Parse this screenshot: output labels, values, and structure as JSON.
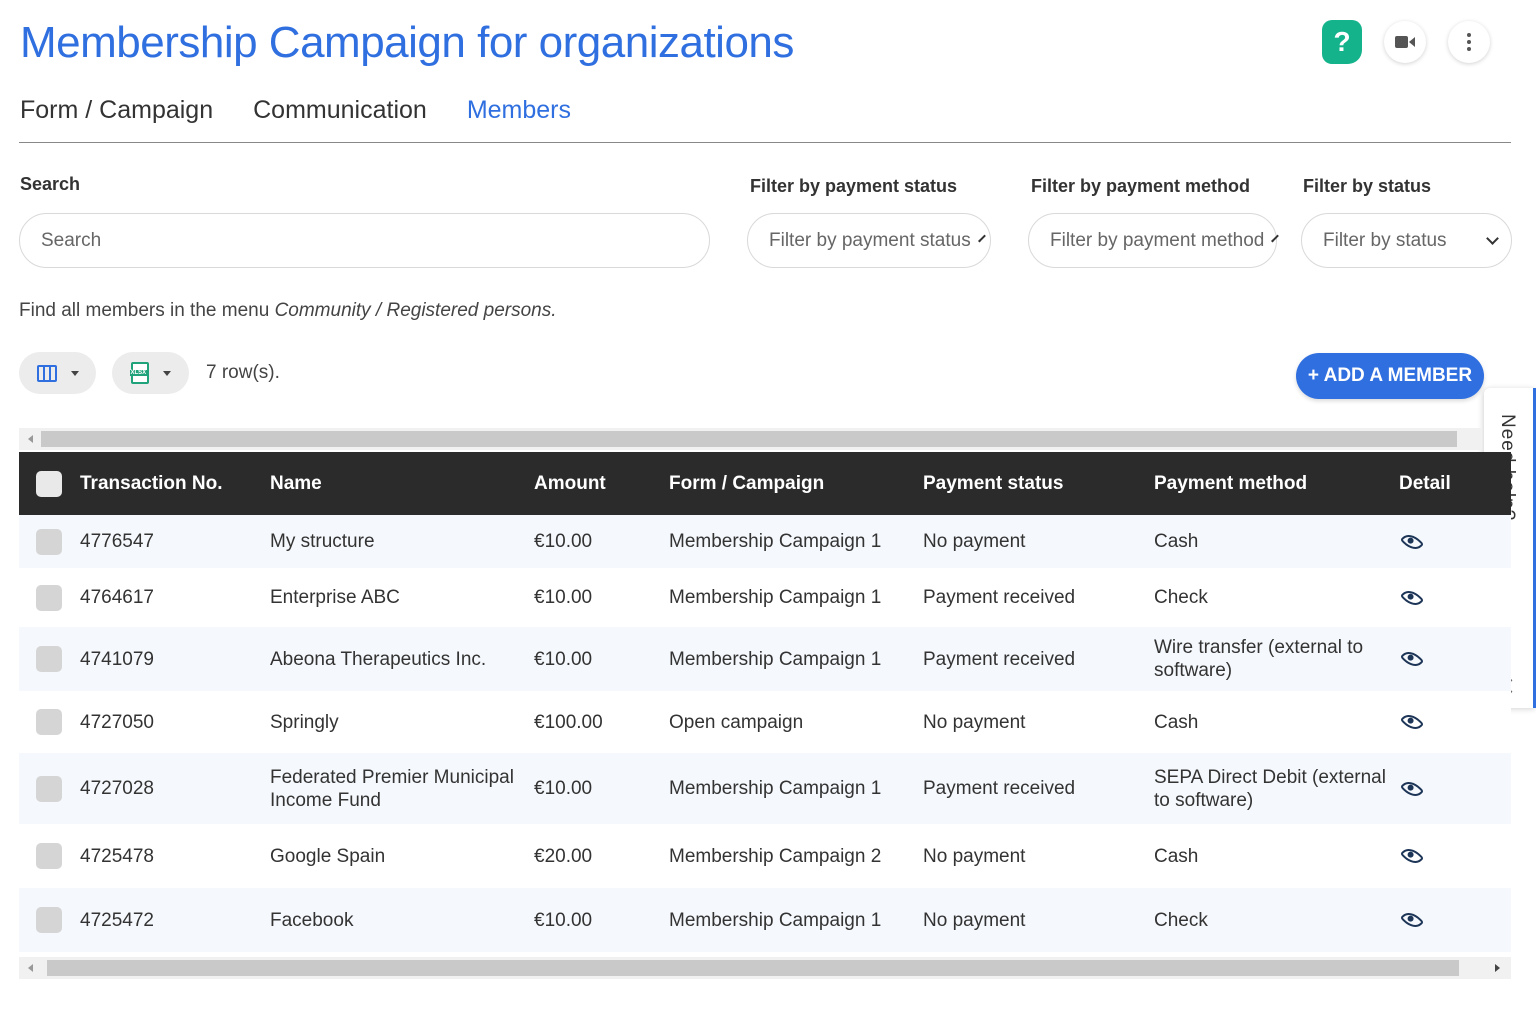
{
  "header": {
    "title": "Membership Campaign for organizations",
    "help_label": "?"
  },
  "tabs": [
    {
      "label": "Form / Campaign",
      "active": false
    },
    {
      "label": "Communication",
      "active": false
    },
    {
      "label": "Members",
      "active": true
    }
  ],
  "filters": {
    "search": {
      "label": "Search",
      "placeholder": "Search"
    },
    "payment_status": {
      "label": "Filter by payment status",
      "value": "Filter by payment status"
    },
    "payment_method": {
      "label": "Filter by payment method",
      "value": "Filter by payment method"
    },
    "status": {
      "label": "Filter by status",
      "value": "Filter by status"
    }
  },
  "info": {
    "prefix": "Find all members in the menu ",
    "menu_path": "Community / Registered persons."
  },
  "toolbar": {
    "row_count": "7 row(s).",
    "add_member_label": "+ ADD A MEMBER"
  },
  "side_panel": {
    "label": "Need help?"
  },
  "table": {
    "columns": [
      "Transaction No.",
      "Name",
      "Amount",
      "Form / Campaign",
      "Payment status",
      "Payment method",
      "Detail"
    ],
    "rows": [
      {
        "txn": "4776547",
        "name": "My structure",
        "amount": "€10.00",
        "campaign": "Membership Campaign 1",
        "payment_status": "No payment",
        "payment_method": "Cash"
      },
      {
        "txn": "4764617",
        "name": "Enterprise ABC",
        "amount": "€10.00",
        "campaign": "Membership Campaign 1",
        "payment_status": "Payment received",
        "payment_method": "Check"
      },
      {
        "txn": "4741079",
        "name": "Abeona Therapeutics Inc.",
        "amount": "€10.00",
        "campaign": "Membership Campaign 1",
        "payment_status": "Payment received",
        "payment_method": "Wire transfer (external to software)"
      },
      {
        "txn": "4727050",
        "name": "Springly",
        "amount": "€100.00",
        "campaign": "Open campaign",
        "payment_status": "No payment",
        "payment_method": "Cash"
      },
      {
        "txn": "4727028",
        "name": "Federated Premier Municipal Income Fund",
        "amount": "€10.00",
        "campaign": "Membership Campaign 1",
        "payment_status": "Payment received",
        "payment_method": "SEPA Direct Debit (external to software)"
      },
      {
        "txn": "4725478",
        "name": "Google Spain",
        "amount": "€20.00",
        "campaign": "Membership Campaign 2",
        "payment_status": "No payment",
        "payment_method": "Cash"
      },
      {
        "txn": "4725472",
        "name": "Facebook",
        "amount": "€10.00",
        "campaign": "Membership Campaign 1",
        "payment_status": "No payment",
        "payment_method": "Check"
      }
    ]
  },
  "colors": {
    "accent": "#2f6fe0",
    "help_green": "#14b38c",
    "header_dark": "#2b2b2b"
  }
}
